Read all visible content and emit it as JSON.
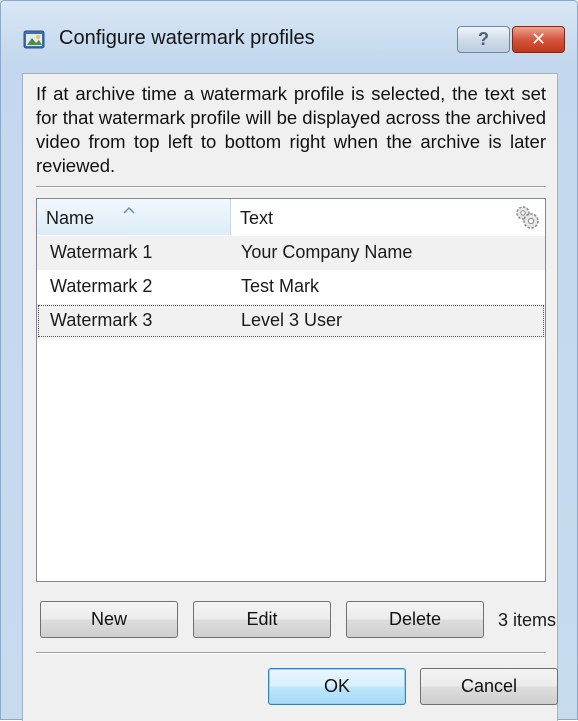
{
  "window": {
    "title": "Configure watermark profiles",
    "help_symbol": "?",
    "close_symbol": "✕"
  },
  "description": "If at archive time a watermark profile is selected, the text set for that watermark profile will be displayed across the archived video from top left to bottom right when the archive is later reviewed.",
  "table": {
    "columns": [
      "Name",
      "Text"
    ],
    "sort_column": "Name",
    "sort_direction": "ascending",
    "rows": [
      {
        "name": "Watermark 1",
        "text": "Your Company Name"
      },
      {
        "name": "Watermark 2",
        "text": "Test Mark"
      },
      {
        "name": "Watermark 3",
        "text": "Level 3 User",
        "focused": true
      }
    ],
    "column_chooser_icon": "gear-icon"
  },
  "buttons": {
    "new": "New",
    "edit": "Edit",
    "delete": "Delete",
    "ok": "OK",
    "cancel": "Cancel"
  },
  "item_count": "3 items",
  "colors": {
    "close_button": "#c8432a",
    "default_button_border": "#3c7fb1"
  }
}
